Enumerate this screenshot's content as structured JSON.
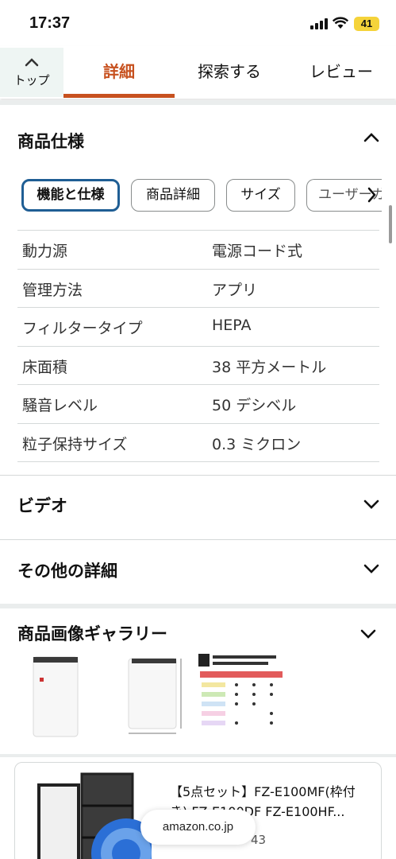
{
  "status_bar": {
    "time": "17:37",
    "battery": "41"
  },
  "tabs": {
    "top_label": "トップ",
    "items": [
      {
        "label": "詳細",
        "active": true
      },
      {
        "label": "探索する",
        "active": false
      },
      {
        "label": "レビュー",
        "active": false
      }
    ]
  },
  "specs_section": {
    "title": "商品仕様",
    "expanded": true,
    "pills": [
      "機能と仕様",
      "商品詳細",
      "サイズ",
      "ユーザーガイド"
    ],
    "active_pill": "機能と仕様",
    "rows": [
      {
        "key": "動力源",
        "value": "電源コード式"
      },
      {
        "key": "管理方法",
        "value": "アプリ"
      },
      {
        "key": "フィルタータイプ",
        "value": "HEPA"
      },
      {
        "key": "床面積",
        "value": "38 平方メートル"
      },
      {
        "key": "騒音レベル",
        "value": "50 デシベル"
      },
      {
        "key": "粒子保持サイズ",
        "value": "0.3 ミクロン"
      }
    ]
  },
  "video_section": {
    "title": "ビデオ"
  },
  "other_section": {
    "title": "その他の詳細"
  },
  "gallery_section": {
    "title": "商品画像ギャラリー"
  },
  "product_card": {
    "title": "【5点セット】FZ-E100MF(枠付き) FZ-E100DF FZ-E100HF...",
    "rating_count": "43",
    "stars": 4.5
  },
  "url_bar": {
    "domain": "amazon.co.jp"
  },
  "colors": {
    "accent": "#c7511f",
    "selected_border": "#1f5e94",
    "star": "#f0a33a"
  }
}
